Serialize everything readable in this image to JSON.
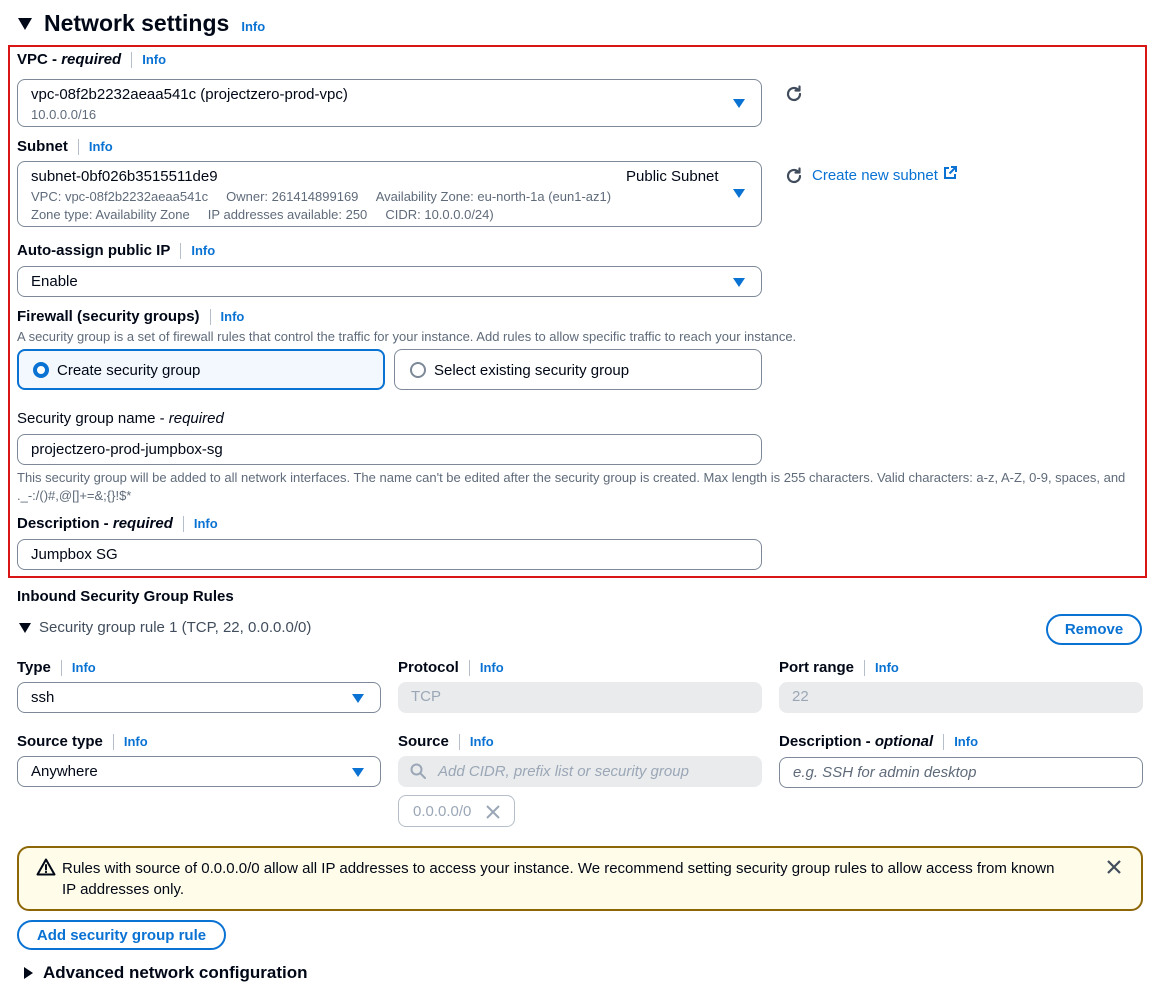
{
  "section": {
    "title": "Network settings",
    "info": "Info"
  },
  "vpc": {
    "label": "VPC - ",
    "required": "required",
    "info": "Info",
    "value": "vpc-08f2b2232aeaa541c (projectzero-prod-vpc)",
    "cidr": "10.0.0.0/16"
  },
  "subnet": {
    "label": "Subnet",
    "info": "Info",
    "value": "subnet-0bf026b3515511de9",
    "tag": "Public Subnet",
    "line2": "VPC: vpc-08f2b2232aeaa541c     Owner: 261414899169     Availability Zone: eu-north-1a (eun1-az1)",
    "line3": "Zone type: Availability Zone     IP addresses available: 250     CIDR: 10.0.0.0/24)",
    "create_link": "Create new subnet"
  },
  "auto_ip": {
    "label": "Auto-assign public IP",
    "info": "Info",
    "value": "Enable"
  },
  "firewall": {
    "label": "Firewall (security groups)",
    "info": "Info",
    "description": "A security group is a set of firewall rules that control the traffic for your instance. Add rules to allow specific traffic to reach your instance.",
    "option_create": "Create security group",
    "option_existing": "Select existing security group"
  },
  "sg_name": {
    "label": "Security group name - ",
    "required": "required",
    "value": "projectzero-prod-jumpbox-sg",
    "help": "This security group will be added to all network interfaces. The name can't be edited after the security group is created. Max length is 255 characters. Valid characters: a-z, A-Z, 0-9, spaces, and ._-:/()#,@[]+=&;{}!$*"
  },
  "description": {
    "label": "Description - ",
    "required": "required",
    "info": "Info",
    "value": "Jumpbox SG"
  },
  "inbound": {
    "title": "Inbound Security Group Rules",
    "rule_title": "Security group rule 1 (TCP, 22, 0.0.0.0/0)",
    "remove": "Remove",
    "type_label": "Type",
    "type_value": "ssh",
    "protocol_label": "Protocol",
    "protocol_value": "TCP",
    "port_label": "Port range",
    "port_value": "22",
    "source_type_label": "Source type",
    "source_type_value": "Anywhere",
    "source_label": "Source",
    "source_placeholder": "Add CIDR, prefix list or security group",
    "source_token": "0.0.0.0/0",
    "desc_label": "Description - ",
    "desc_optional": "optional",
    "desc_placeholder": "e.g. SSH for admin desktop",
    "info": "Info"
  },
  "warning": {
    "text": "Rules with source of 0.0.0.0/0 allow all IP addresses to access your instance. We recommend setting security group rules to allow access from known IP addresses only."
  },
  "add_rule": "Add security group rule",
  "advanced": "Advanced network configuration",
  "colors": {
    "accent": "#0972d3",
    "highlight": "#d91515",
    "warning_border": "#8d6605",
    "warning_bg": "#fffce9"
  }
}
